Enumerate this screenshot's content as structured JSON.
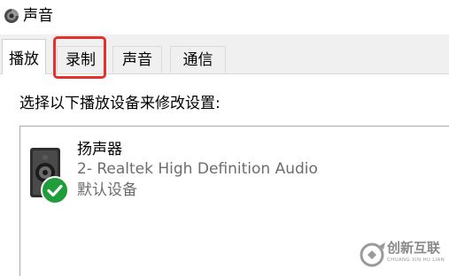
{
  "window": {
    "title": "声音",
    "icon": "speaker-icon"
  },
  "tabs": [
    {
      "label": "播放",
      "active": true
    },
    {
      "label": "录制",
      "active": false,
      "highlighted": true
    },
    {
      "label": "声音",
      "active": false
    },
    {
      "label": "通信",
      "active": false
    }
  ],
  "playback": {
    "instruction": "选择以下播放设备来修改设置:",
    "devices": [
      {
        "name": "扬声器",
        "description": "2- Realtek High Definition Audio",
        "status": "默认设备",
        "icon": "speaker-device-icon",
        "badge": "default-check-icon"
      }
    ]
  },
  "watermark": {
    "text": "创新互联",
    "subtext": "CHUANG XIN HU LIAN"
  },
  "colors": {
    "highlight": "#e5312e",
    "check_green": "#1e9d3a",
    "tab_strip_bg": "#f0f0f0",
    "secondary_text": "#6d6d6d"
  }
}
